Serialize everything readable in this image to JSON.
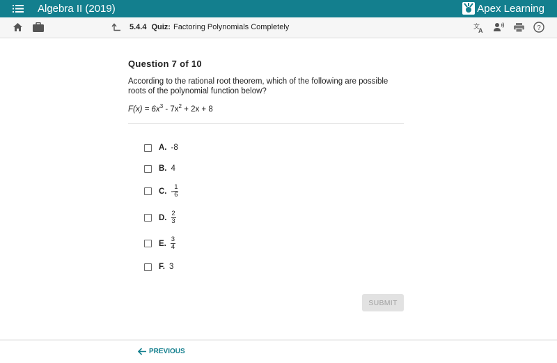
{
  "header": {
    "course_title": "Algebra II (2019)",
    "brand": "Apex Learning",
    "brand_color": "#137f8e"
  },
  "subheader": {
    "lesson_number": "5.4.4",
    "activity_type": "Quiz:",
    "activity_title": "Factoring Polynomials Completely",
    "icons": [
      "home-icon",
      "briefcase-icon",
      "up-arrow-icon",
      "translate-icon",
      "text-to-speech-icon",
      "print-icon",
      "help-icon"
    ]
  },
  "question": {
    "counter": "Question 7 of 10",
    "prompt": "According to the rational root theorem, which of the following are possible roots of the polynomial function below?",
    "formula": {
      "lhs": "F(x) = 6x",
      "exp1": "3",
      "mid": " - 7x",
      "exp2": "2",
      "rhs": " + 2x + 8"
    }
  },
  "choices": [
    {
      "label": "A.",
      "value": "-8",
      "checked": false
    },
    {
      "label": "B.",
      "value": "4",
      "checked": false
    },
    {
      "label": "C.",
      "sign": "-",
      "numerator": "1",
      "denominator": "6",
      "checked": false
    },
    {
      "label": "D.",
      "sign": "",
      "numerator": "2",
      "denominator": "3",
      "checked": false
    },
    {
      "label": "E.",
      "sign": "",
      "numerator": "3",
      "denominator": "4",
      "checked": false
    },
    {
      "label": "F.",
      "value": "3",
      "checked": false
    }
  ],
  "actions": {
    "submit_label": "SUBMIT",
    "previous_label": "PREVIOUS"
  }
}
